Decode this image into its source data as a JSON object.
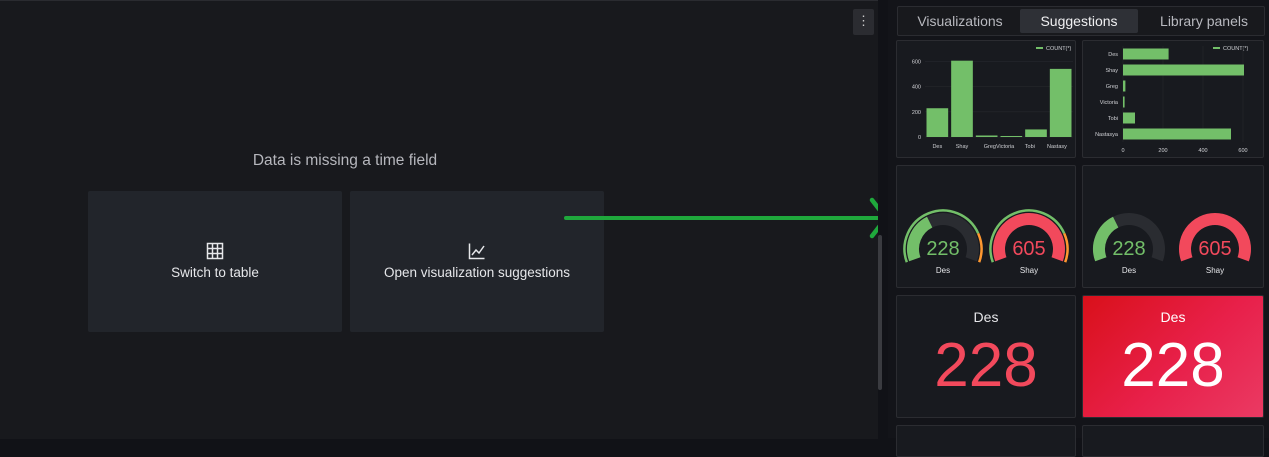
{
  "main": {
    "message": "Data is missing a time field",
    "switch_to_table_label": "Switch to table",
    "open_suggestions_label": "Open visualization suggestions"
  },
  "tabs": [
    {
      "label": "Visualizations",
      "active": false
    },
    {
      "label": "Suggestions",
      "active": true
    },
    {
      "label": "Library panels",
      "active": false
    }
  ],
  "colors": {
    "green": "#73bf69",
    "red": "#f2495c",
    "red_bg": "#e02f44"
  },
  "chart_data": [
    {
      "type": "bar",
      "legend": "COUNT(*)",
      "categories": [
        "Des",
        "Shay",
        "Greg",
        "Victoria",
        "Tobi",
        "Nastasya"
      ],
      "x_tick_labels": [
        "Des",
        "Shay",
        "GregVictoria",
        "Tobi",
        "Nastasy"
      ],
      "values": [
        228,
        605,
        12,
        8,
        60,
        540
      ],
      "yticks": [
        "0",
        "200",
        "400",
        "600"
      ],
      "ylim": [
        0,
        650
      ]
    },
    {
      "type": "bar",
      "orientation": "horizontal",
      "legend": "COUNT(*)",
      "categories": [
        "Des",
        "Shay",
        "Greg",
        "Victoria",
        "Tobi",
        "Nastasya"
      ],
      "values": [
        228,
        605,
        12,
        8,
        60,
        540
      ],
      "xticks": [
        "0",
        "200",
        "400",
        "600"
      ],
      "xlim": [
        0,
        650
      ]
    }
  ],
  "gauges": {
    "a": [
      {
        "label": "Des",
        "value": "228",
        "fraction": 0.38
      },
      {
        "label": "Shay",
        "value": "605",
        "fraction": 1.0
      }
    ],
    "b": [
      {
        "label": "Des",
        "value": "228",
        "fraction": 0.38
      },
      {
        "label": "Shay",
        "value": "605",
        "fraction": 1.0
      }
    ]
  },
  "stats": [
    {
      "label": "Des",
      "value": "228"
    },
    {
      "label": "Des",
      "value": "228"
    }
  ]
}
